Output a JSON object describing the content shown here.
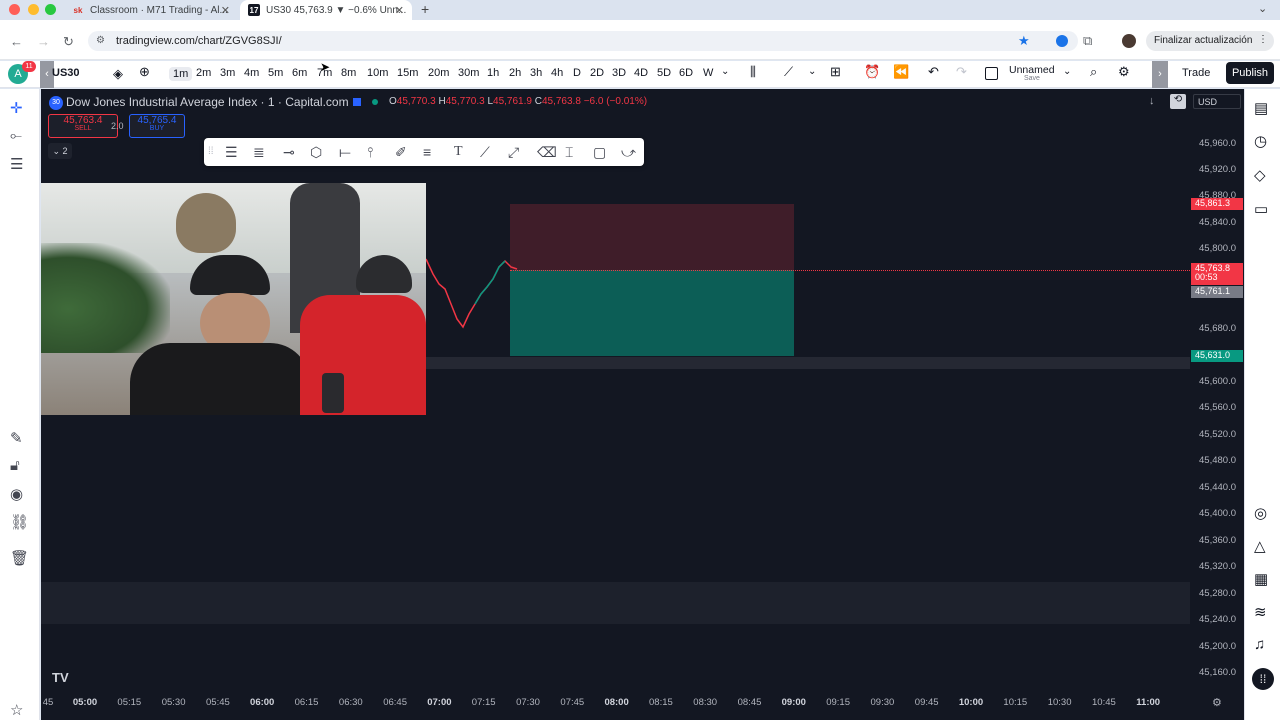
{
  "browser": {
    "tabs": [
      {
        "favicon": "sk",
        "title": "Classroom · M71 Trading - Al..."
      },
      {
        "favicon": "17",
        "title": "US30 45,763.9 ▼ −0.6% Unn..."
      }
    ],
    "url": "tradingview.com/chart/ZGVG8SJI/",
    "update_button": "Finalizar actualización"
  },
  "toolbar": {
    "symbol": "US30",
    "avatar_letter": "A",
    "notification_count": "11",
    "timeframes": [
      "1m",
      "2m",
      "3m",
      "4m",
      "5m",
      "6m",
      "7m",
      "8m",
      "10m",
      "15m",
      "20m",
      "30m",
      "1h",
      "2h",
      "3h",
      "4h",
      "D",
      "2D",
      "3D",
      "4D",
      "5D",
      "6D",
      "W"
    ],
    "selected_timeframe": "1m",
    "layout_name": "Unnamed",
    "layout_sub": "Save",
    "trade_label": "Trade",
    "publish_label": "Publish"
  },
  "chart": {
    "instrument": "Dow Jones Industrial Average Index · 1 · Capital.com",
    "ohlc": {
      "o_label": "O",
      "o": "45,770.3",
      "h_label": "H",
      "h": "45,770.3",
      "l_label": "L",
      "l": "45,761.9",
      "c_label": "C",
      "c": "45,763.8",
      "change": "−6.0 (−0.01%)"
    },
    "sell_price": "45,763.4",
    "sell_label": "SELL",
    "spread": "2.0",
    "buy_price": "45,765.4",
    "buy_label": "BUY",
    "indicators_toggle": "2",
    "currency": "USD",
    "price_labels": [
      "45,960.0",
      "45,920.0",
      "45,880.0",
      "45,840.0",
      "45,800.0",
      "45,680.0",
      "45,600.0",
      "45,560.0",
      "45,520.0",
      "45,480.0",
      "45,440.0",
      "45,400.0",
      "45,360.0",
      "45,320.0",
      "45,280.0",
      "45,240.0",
      "45,200.0",
      "45,160.0"
    ],
    "stop_tag": "45,861.3",
    "current_tag": "45,763.8",
    "countdown": "00:53",
    "bid_tag": "45,761.1",
    "target_tag": "45,631.0",
    "time_labels": [
      {
        "t": "45",
        "bold": false
      },
      {
        "t": "05:00",
        "bold": true
      },
      {
        "t": "05:15",
        "bold": false
      },
      {
        "t": "05:30",
        "bold": false
      },
      {
        "t": "05:45",
        "bold": false
      },
      {
        "t": "06:00",
        "bold": true
      },
      {
        "t": "06:15",
        "bold": false
      },
      {
        "t": "06:30",
        "bold": false
      },
      {
        "t": "06:45",
        "bold": false
      },
      {
        "t": "07:00",
        "bold": true
      },
      {
        "t": "07:15",
        "bold": false
      },
      {
        "t": "07:30",
        "bold": false
      },
      {
        "t": "07:45",
        "bold": false
      },
      {
        "t": "08:00",
        "bold": true
      },
      {
        "t": "08:15",
        "bold": false
      },
      {
        "t": "08:30",
        "bold": false
      },
      {
        "t": "08:45",
        "bold": false
      },
      {
        "t": "09:00",
        "bold": true
      },
      {
        "t": "09:15",
        "bold": false
      },
      {
        "t": "09:30",
        "bold": false
      },
      {
        "t": "09:45",
        "bold": false
      },
      {
        "t": "10:00",
        "bold": true
      },
      {
        "t": "10:15",
        "bold": false
      },
      {
        "t": "10:30",
        "bold": false
      },
      {
        "t": "10:45",
        "bold": false
      },
      {
        "t": "11:00",
        "bold": true
      }
    ]
  },
  "colors": {
    "chart_bg": "#131722",
    "up": "#089981",
    "down": "#f23645",
    "accent": "#2962ff"
  }
}
